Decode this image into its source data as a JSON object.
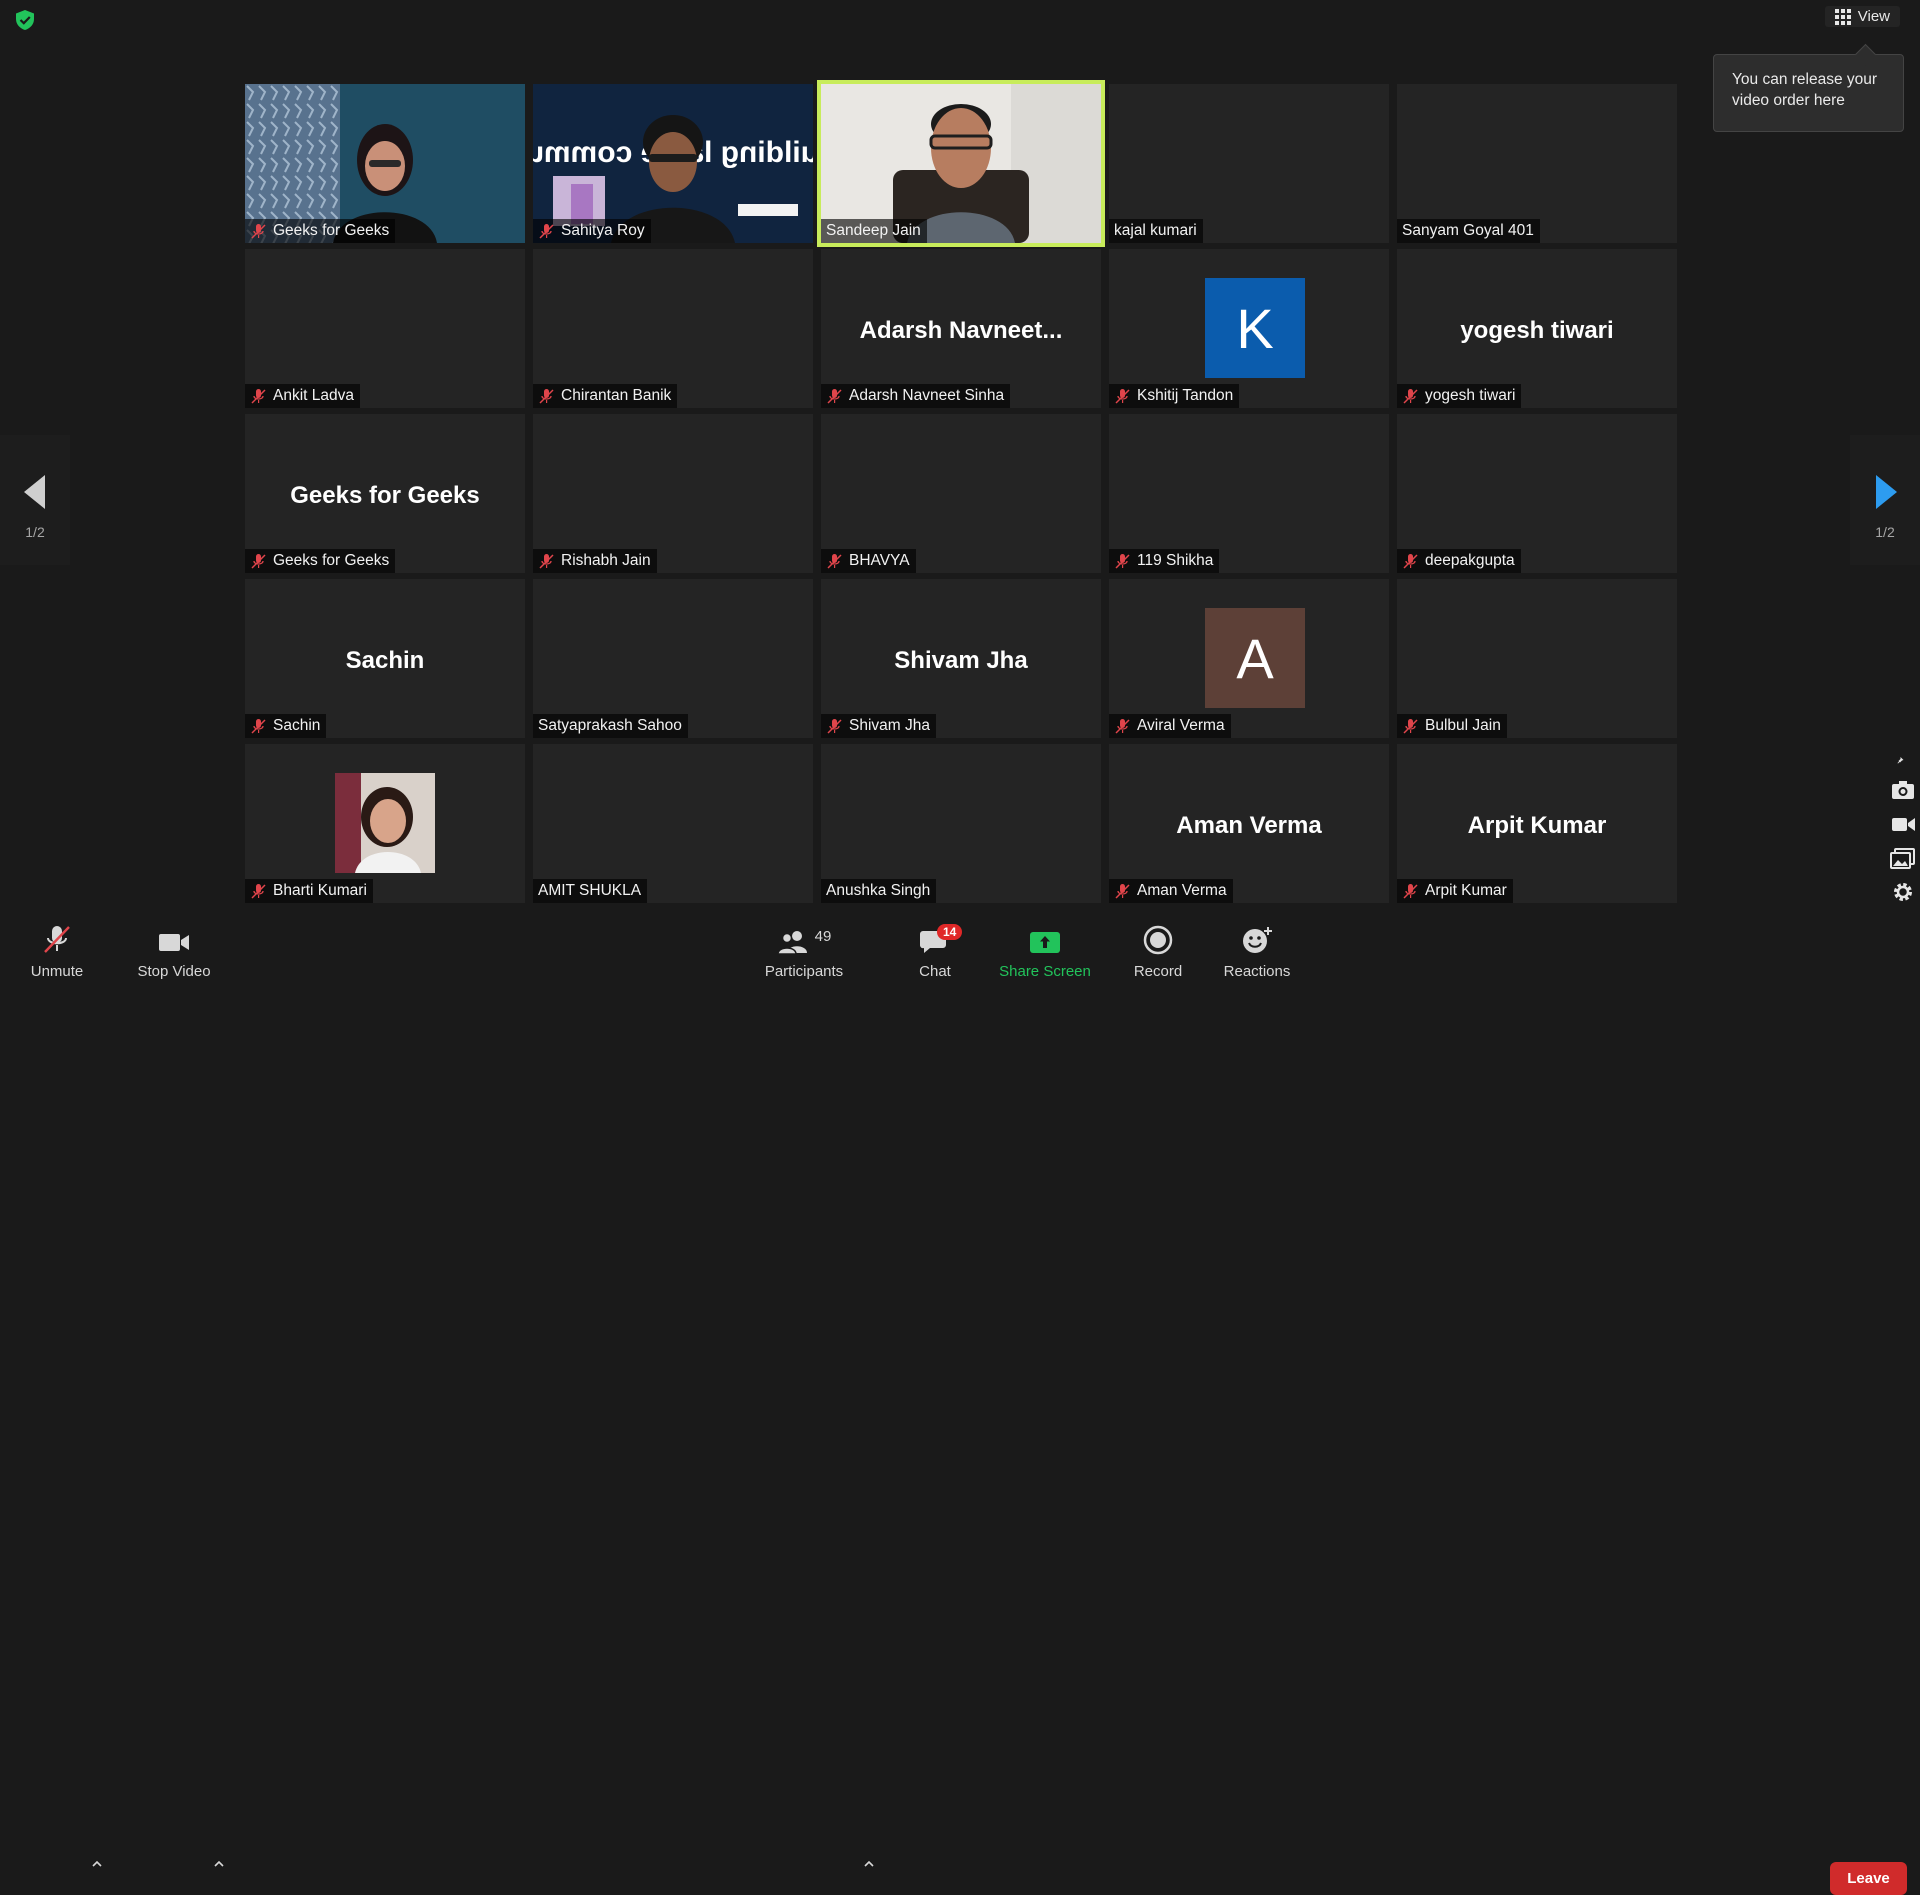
{
  "top_bar": {
    "security_icon": "shield-check-icon",
    "view_label": "View",
    "tooltip_text": "You can release your video order here"
  },
  "pagination": {
    "left_label": "1/2",
    "right_label": "1/2"
  },
  "participants": [
    {
      "name": "Geeks for Geeks",
      "muted": true,
      "video": "woman-video"
    },
    {
      "name": "Sahitya Roy",
      "muted": true,
      "video": "man-slide-video"
    },
    {
      "name": "Sandeep Jain",
      "muted": false,
      "video": "man-office-video",
      "active_speaker": true
    },
    {
      "name": "kajal kumari",
      "muted": false
    },
    {
      "name": "Sanyam Goyal 401",
      "muted": false
    },
    {
      "name": "Ankit Ladva",
      "muted": true
    },
    {
      "name": "Chirantan Banik",
      "muted": true
    },
    {
      "name": "Adarsh Navneet Sinha",
      "muted": true,
      "display_name": "Adarsh  Navneet..."
    },
    {
      "name": "Kshitij Tandon",
      "muted": true,
      "avatar_letter": "K",
      "avatar_color": "#0b5cad"
    },
    {
      "name": "yogesh tiwari",
      "muted": true,
      "display_name": "yogesh tiwari"
    },
    {
      "name": "Geeks for Geeks",
      "muted": true,
      "display_name": "Geeks for Geeks"
    },
    {
      "name": "Rishabh Jain",
      "muted": true
    },
    {
      "name": "BHAVYA",
      "muted": true
    },
    {
      "name": "119 Shikha",
      "muted": true
    },
    {
      "name": "deepakgupta",
      "muted": true
    },
    {
      "name": "Sachin",
      "muted": true,
      "display_name": "Sachin"
    },
    {
      "name": "Satyaprakash Sahoo",
      "muted": false
    },
    {
      "name": "Shivam Jha",
      "muted": true,
      "display_name": "Shivam Jha"
    },
    {
      "name": "Aviral Verma",
      "muted": true,
      "avatar_letter": "A",
      "avatar_color": "#5d4037"
    },
    {
      "name": "Bulbul Jain",
      "muted": true
    },
    {
      "name": "Bharti Kumari",
      "muted": true,
      "photo": "woman-profile-photo"
    },
    {
      "name": "AMIT SHUKLA",
      "muted": false
    },
    {
      "name": "Anushka Singh",
      "muted": false
    },
    {
      "name": "Aman Verma",
      "muted": true,
      "display_name": "Aman Verma"
    },
    {
      "name": "Arpit Kumar",
      "muted": true,
      "display_name": "Arpit Kumar"
    }
  ],
  "toolbar": {
    "unmute_label": "Unmute",
    "stop_video_label": "Stop Video",
    "participants_label": "Participants",
    "participants_count": "49",
    "chat_label": "Chat",
    "chat_badge": "14",
    "share_screen_label": "Share Screen",
    "record_label": "Record",
    "reactions_label": "Reactions",
    "leave_label": "Leave"
  },
  "colors": {
    "active_speaker_border": "#c8ec5b",
    "share_screen": "#22c35b",
    "leave": "#d02b2b",
    "pager_next": "#2d9cf0",
    "muted_icon": "#e0454b"
  }
}
